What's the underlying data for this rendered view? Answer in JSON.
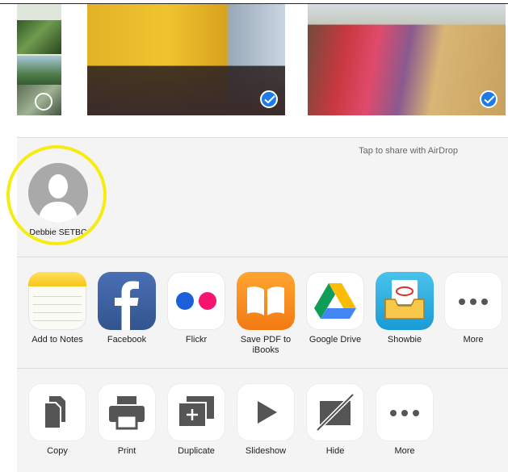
{
  "airdrop": {
    "hint": "Tap to share with AirDrop",
    "contact_name": "Debbie SETBC"
  },
  "share_row": [
    {
      "id": "notes",
      "label": "Add to Notes",
      "icon": "notes-icon"
    },
    {
      "id": "facebook",
      "label": "Facebook",
      "icon": "facebook-icon"
    },
    {
      "id": "flickr",
      "label": "Flickr",
      "icon": "flickr-icon"
    },
    {
      "id": "ibooks",
      "label": "Save PDF to iBooks",
      "icon": "ibooks-icon"
    },
    {
      "id": "gdrive",
      "label": "Google Drive",
      "icon": "google-drive-icon"
    },
    {
      "id": "showbie",
      "label": "Showbie",
      "icon": "showbie-icon"
    },
    {
      "id": "more",
      "label": "More",
      "icon": "more-icon"
    }
  ],
  "action_row": [
    {
      "id": "copy",
      "label": "Copy",
      "icon": "copy-icon"
    },
    {
      "id": "print",
      "label": "Print",
      "icon": "print-icon"
    },
    {
      "id": "duplicate",
      "label": "Duplicate",
      "icon": "duplicate-icon"
    },
    {
      "id": "slideshow",
      "label": "Slideshow",
      "icon": "play-icon"
    },
    {
      "id": "hide",
      "label": "Hide",
      "icon": "hide-icon"
    },
    {
      "id": "more",
      "label": "More",
      "icon": "more-icon"
    }
  ],
  "colors": {
    "selection_blue": "#1f7ae8",
    "highlight_yellow": "#f5ec12",
    "sheet_background": "#f4f4f4"
  }
}
